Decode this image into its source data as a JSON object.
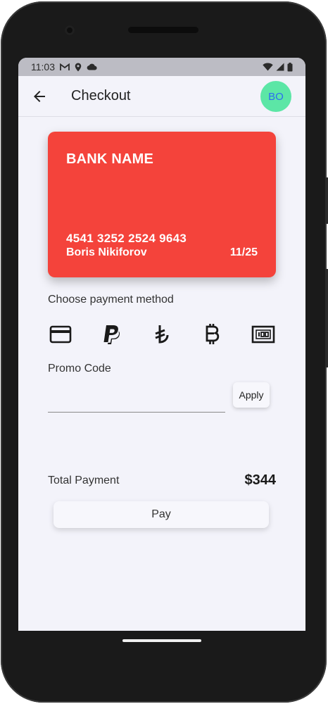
{
  "status_bar": {
    "time": "11:03",
    "icons": [
      "gmail-icon",
      "location-icon",
      "cloud-icon",
      "wifi-icon",
      "signal-icon",
      "battery-icon"
    ]
  },
  "app_bar": {
    "back_icon": "arrow-back-icon",
    "title": "Checkout",
    "avatar_initials": "BO"
  },
  "card": {
    "bank_name": "BANK NAME",
    "number": "4541 3252 2524 9643",
    "holder": "Boris Nikiforov",
    "expiry": "11/25",
    "color": "#f4433b"
  },
  "payment_method": {
    "label": "Choose payment method",
    "options": [
      {
        "icon": "credit-card-icon"
      },
      {
        "icon": "paypal-icon"
      },
      {
        "icon": "lira-icon"
      },
      {
        "icon": "bitcoin-icon"
      },
      {
        "icon": "cash-icon"
      }
    ]
  },
  "promo": {
    "label": "Promo Code",
    "value": "",
    "placeholder": "",
    "apply_label": "Apply"
  },
  "total": {
    "label": "Total Payment",
    "amount": "$344"
  },
  "pay_button": {
    "label": "Pay"
  },
  "colors": {
    "avatar_bg": "#5ce6a6",
    "avatar_text": "#2d6df0",
    "screen_bg": "#f3f3fa"
  }
}
